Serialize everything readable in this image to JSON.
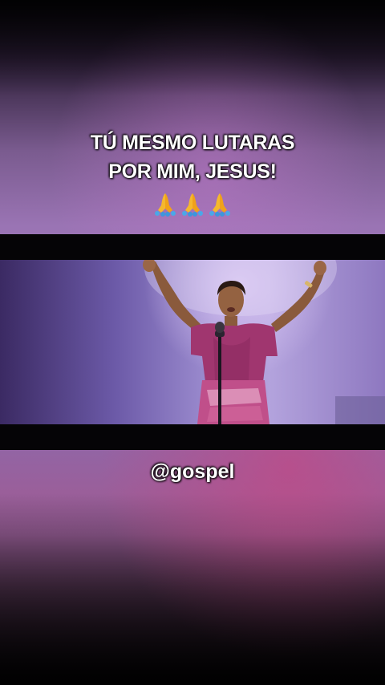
{
  "caption": {
    "line1": "TÚ MESMO LUTARAS",
    "line2": "POR MIM, JESUS!"
  },
  "emojis": [
    "praying-hands-icon",
    "praying-hands-icon",
    "praying-hands-icon"
  ],
  "handle": "@gospel",
  "colors": {
    "background_purple": "#8c69ad",
    "background_pink": "#c84682",
    "letterbox": "#050406",
    "dress": "#a0366f",
    "text": "#ffffff"
  }
}
